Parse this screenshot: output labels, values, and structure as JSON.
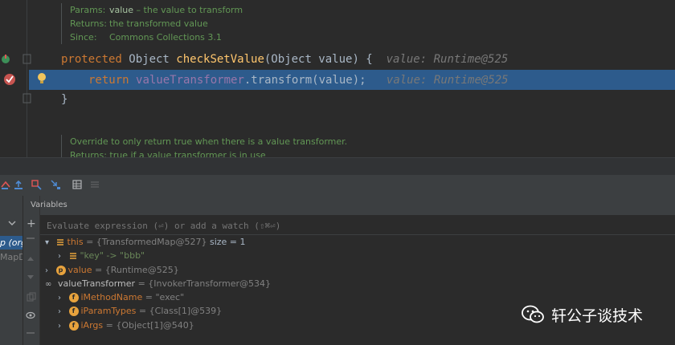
{
  "editor": {
    "doc1": {
      "params_label": "Params:",
      "params_value_name": "value",
      "params_value_desc": " – the value to transform",
      "returns_label": "Returns:",
      "returns_value": "the transformed value",
      "since_label": "Since:",
      "since_value": "Commons Collections 3.1"
    },
    "line1": {
      "kw": "protected",
      "type": " Object ",
      "method": "checkSetValue",
      "params": "(Object value) {",
      "hint": "value: Runtime@525"
    },
    "line2": {
      "kw": "return ",
      "field": "valueTransformer",
      "call": ".transform(value);",
      "hint": "value: Runtime@525"
    },
    "line3": "}",
    "doc2": {
      "line1": "Override to only return true when there is a value transformer.",
      "line2": "Returns: true if a value transformer is in use"
    }
  },
  "debugger": {
    "panel_title": "Variables",
    "eval_placeholder": "Evaluate expression (⏎) or add a watch (⇧⌘⏎)",
    "frames_partial": [
      "p (org",
      "MapD"
    ],
    "variables": [
      {
        "name": "this",
        "value": "= {TransformedMap@527}",
        "extra": " size = 1"
      },
      {
        "name": "\"key\" -> \"bbb\"",
        "value": ""
      },
      {
        "name": "value",
        "value": "= {Runtime@525}"
      },
      {
        "name": "valueTransformer",
        "value": "= {InvokerTransformer@534}"
      },
      {
        "name": "iMethodName",
        "value": "= \"exec\""
      },
      {
        "name": "iParamTypes",
        "value": "= {Class[1]@539}"
      },
      {
        "name": "iArgs",
        "value": "= {Object[1]@540}"
      }
    ]
  },
  "watermark": {
    "text": "轩公子谈技术"
  },
  "colors": {
    "highlight": "#2d5b8c",
    "keyword": "#cc7832",
    "method": "#ffc66d",
    "field": "#9876aa",
    "doc": "#629755",
    "string": "#6a8759"
  }
}
